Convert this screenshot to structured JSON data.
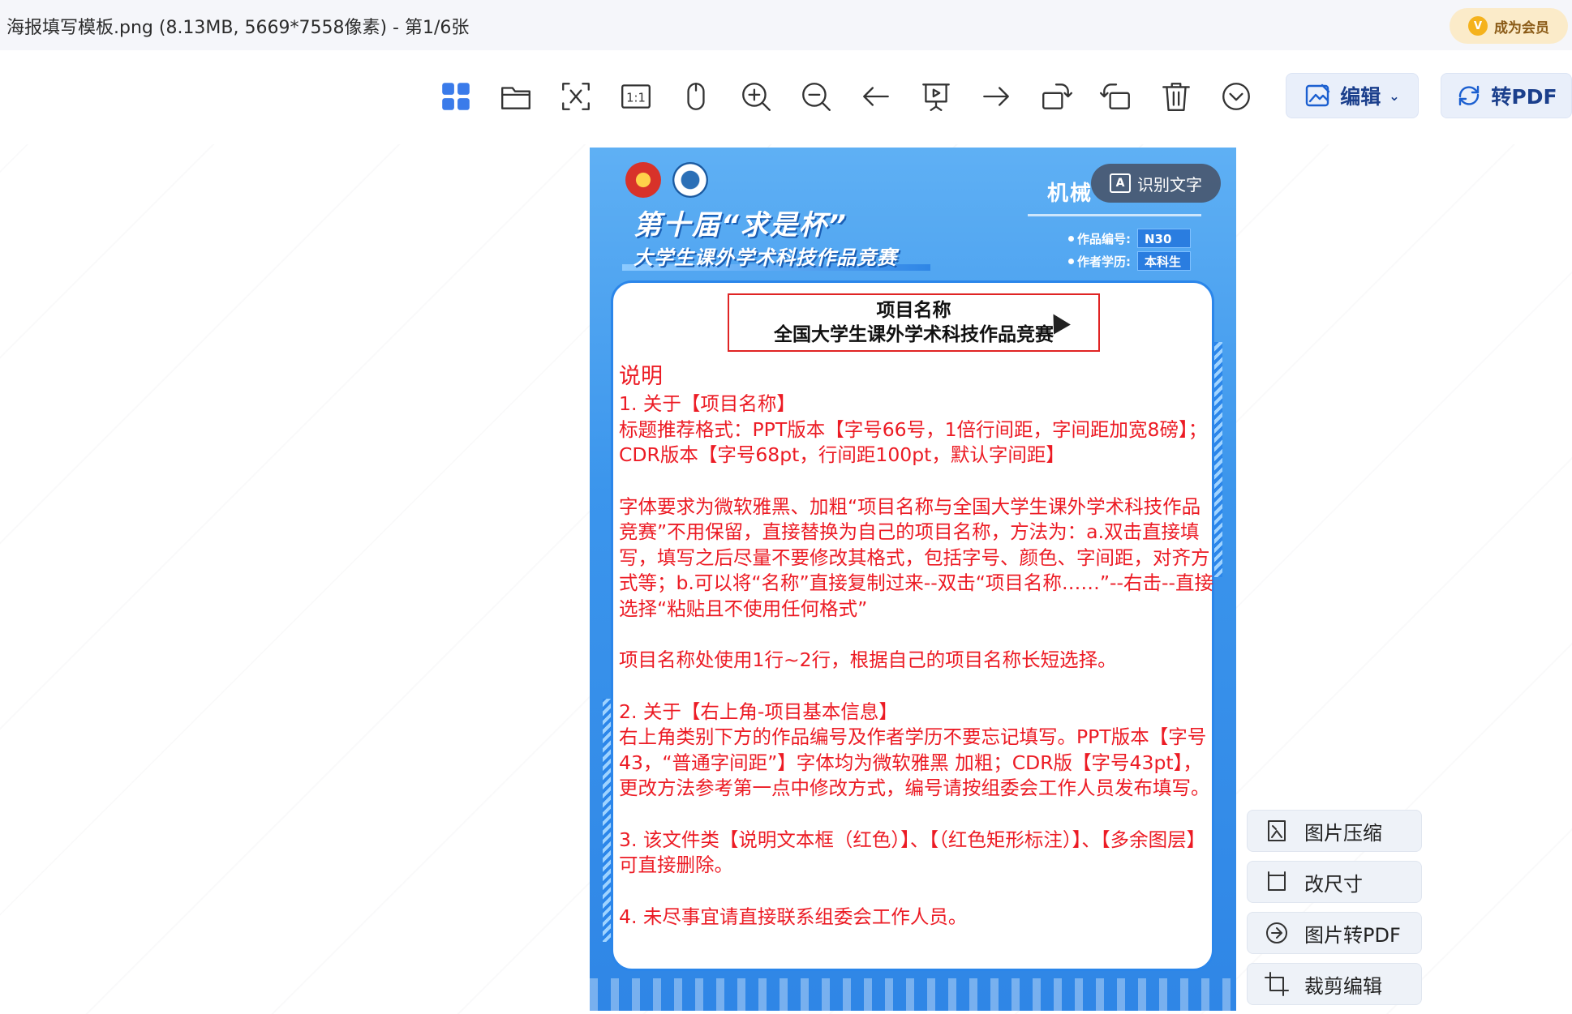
{
  "window": {
    "title": "海报填写模板.png (8.13MB, 5669*7558像素) - 第1/6张",
    "vip_label": "成为会员",
    "vip_icon_glyph": "V"
  },
  "toolbar": {
    "edit_label": "编辑",
    "pdf_label": "转PDF",
    "actual_size_label": "1:1",
    "icons": [
      "grid-view-icon",
      "open-folder-icon",
      "ocr-scan-icon",
      "actual-size-icon",
      "mouse-icon",
      "zoom-in-icon",
      "zoom-out-icon",
      "previous-icon",
      "slideshow-icon",
      "next-icon",
      "rotate-left-icon",
      "rotate-right-icon",
      "delete-icon",
      "more-icon"
    ],
    "accent_color": "#3a7bea"
  },
  "image": {
    "ocr_button_label": "识别文字",
    "ocr_icon_glyph": "A",
    "poster": {
      "heading_line1": "第十届“求是杯”",
      "heading_line2": "大学生课外学术科技作品竞赛",
      "category_partial": "机械",
      "work_no_label": "作品编号:",
      "work_no_value": "N30",
      "education_label": "作者学历:",
      "education_value": "本科生",
      "name_box_line1": "项目名称",
      "name_box_line2": "全国大学生课外学术科技作品竞赛",
      "notes_title": "说明",
      "note1_title": "1. 关于【项目名称】",
      "note1_text": "标题推荐格式：PPT版本【字号66号，1倍行间距，字间距加宽8磅】；CDR版本【字号68pt，行间距100pt，默认字间距】",
      "note1_text2": "字体要求为微软雅黑、加粗“项目名称与全国大学生课外学术科技作品竞赛”不用保留，直接替换为自己的项目名称，方法为：a.双击直接填写，填写之后尽量不要修改其格式，包括字号、颜色、字间距，对齐方式等；b.可以将“名称”直接复制过来--双击“项目名称……”--右击--直接选择“粘贴且不使用任何格式”",
      "note1_text3": "项目名称处使用1行~2行，根据自己的项目名称长短选择。",
      "note2_title": "2. 关于【右上角-项目基本信息】",
      "note2_text": "右上角类别下方的作品编号及作者学历不要忘记填写。PPT版本【字号43，“普通字间距”】字体均为微软雅黑 加粗；CDR版【字号43pt】，更改方法参考第一点中修改方式，编号请按组委会工作人员发布填写。",
      "note3_text": "3. 该文件类【说明文本框（红色）】、【（红色矩形标注）】、【多余图层】可直接删除。",
      "note4_text": "4. 未尽事宜请直接联系组委会工作人员。",
      "note_color": "#ec1b24",
      "poster_blue": "#2f86e6"
    }
  },
  "side_tools": [
    {
      "label": "图片压缩",
      "icon": "compress-icon"
    },
    {
      "label": "改尺寸",
      "icon": "resize-icon"
    },
    {
      "label": "图片转PDF",
      "icon": "image-to-pdf-icon"
    },
    {
      "label": "裁剪编辑",
      "icon": "crop-icon"
    }
  ]
}
